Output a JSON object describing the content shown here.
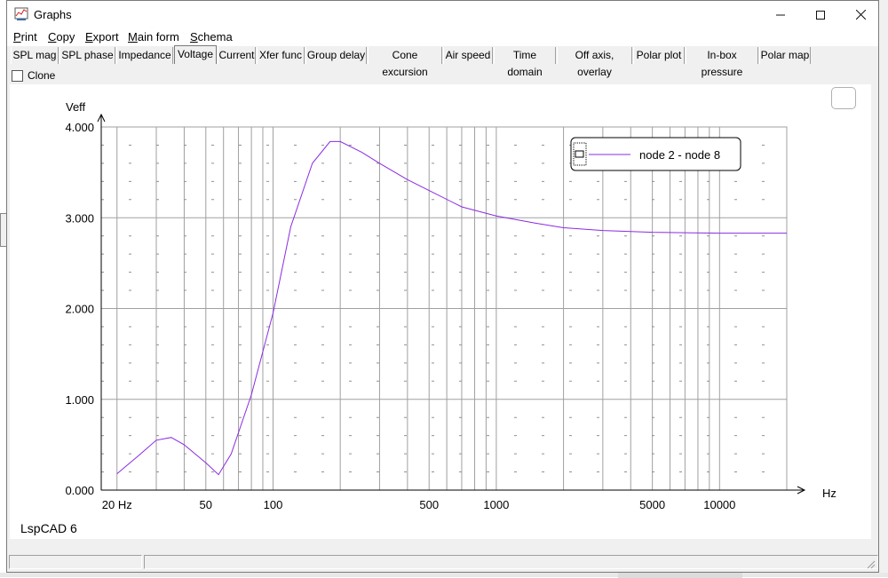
{
  "window": {
    "title": "Graphs",
    "minimize_icon": "minimize-icon",
    "maximize_icon": "maximize-icon",
    "close_icon": "close-icon"
  },
  "menu": [
    {
      "ul": "P",
      "rest": "rint"
    },
    {
      "ul": "C",
      "rest": "opy"
    },
    {
      "ul": "E",
      "rest": "xport"
    },
    {
      "ul": "M",
      "rest": "ain form"
    },
    {
      "ul": "S",
      "rest": "chema"
    }
  ],
  "tabs": [
    "SPL mag",
    "SPL phase",
    "Impedance",
    "Voltage",
    "Current",
    "Xfer func",
    "Group delay",
    "Cone excursion",
    "Air speed",
    "Time domain",
    "Off axis, overlay",
    "Polar plot",
    "In-box pressure",
    "Polar map"
  ],
  "active_tab": "Voltage",
  "clone_label": "Clone",
  "clone_checked": false,
  "chart_data": {
    "type": "line",
    "ylabel": "Veff",
    "xlabel": "Hz",
    "x_scale": "log",
    "xlim": [
      17,
      20000
    ],
    "ylim": [
      0,
      4
    ],
    "x_ticks": [
      {
        "value": 20,
        "label": "20 Hz"
      },
      {
        "value": 50,
        "label": "50"
      },
      {
        "value": 100,
        "label": "100"
      },
      {
        "value": 500,
        "label": "500"
      },
      {
        "value": 1000,
        "label": "1000"
      },
      {
        "value": 5000,
        "label": "5000"
      },
      {
        "value": 10000,
        "label": "10000"
      }
    ],
    "y_ticks": [
      {
        "value": 0,
        "label": "0.000"
      },
      {
        "value": 1,
        "label": "1.000"
      },
      {
        "value": 2,
        "label": "2.000"
      },
      {
        "value": 3,
        "label": "3.000"
      },
      {
        "value": 4,
        "label": "4.000"
      }
    ],
    "grid": true,
    "legend_position": "top-right",
    "series_color": "#8a2be2",
    "series": [
      {
        "name": "node 2 - node 8",
        "points": [
          [
            20,
            0.18
          ],
          [
            25,
            0.38
          ],
          [
            30,
            0.55
          ],
          [
            35,
            0.58
          ],
          [
            40,
            0.5
          ],
          [
            50,
            0.3
          ],
          [
            57,
            0.17
          ],
          [
            65,
            0.4
          ],
          [
            80,
            1.05
          ],
          [
            100,
            1.95
          ],
          [
            120,
            2.9
          ],
          [
            150,
            3.6
          ],
          [
            180,
            3.84
          ],
          [
            200,
            3.84
          ],
          [
            250,
            3.72
          ],
          [
            300,
            3.6
          ],
          [
            400,
            3.42
          ],
          [
            500,
            3.3
          ],
          [
            700,
            3.12
          ],
          [
            1000,
            3.02
          ],
          [
            1500,
            2.94
          ],
          [
            2000,
            2.89
          ],
          [
            3000,
            2.86
          ],
          [
            5000,
            2.84
          ],
          [
            10000,
            2.83
          ],
          [
            20000,
            2.83
          ]
        ]
      }
    ]
  },
  "watermark": "LspCAD 6"
}
